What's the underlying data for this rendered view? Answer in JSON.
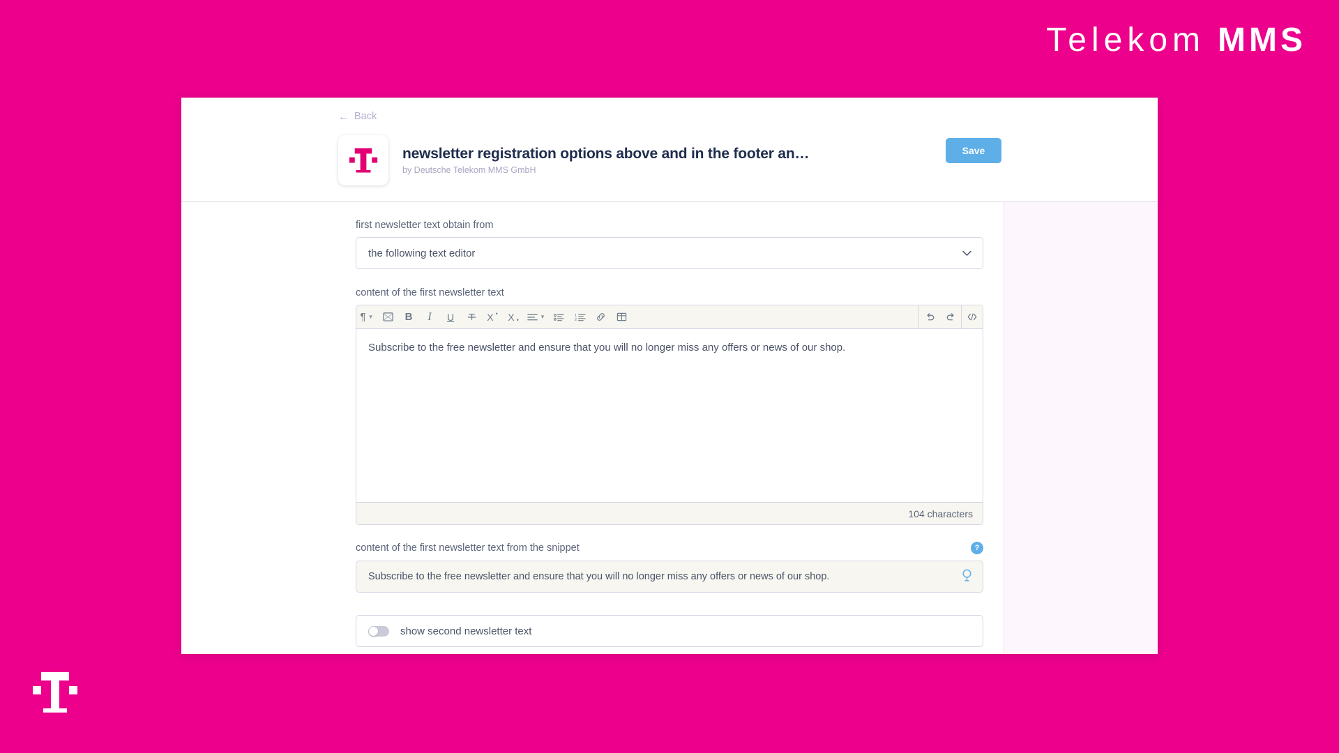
{
  "brand": {
    "wordmark_light": "Telekom",
    "wordmark_bold": "MMS",
    "magenta": "#EC008C",
    "corner_logo_name": "telekom-t-logo"
  },
  "header": {
    "back_label": "Back",
    "back_arrow": "←",
    "app_icon_name": "telekom-t-app-icon",
    "title": "newsletter registration options above and in the footer an…",
    "subtitle": "by Deutsche Telekom MMS GmbH",
    "save_label": "Save",
    "save_color": "#5EAEE8"
  },
  "form": {
    "source_field": {
      "label": "first newsletter text obtain from",
      "value": "the following text editor",
      "options": [
        "the following text editor"
      ]
    },
    "editor_field": {
      "label": "content of the first newsletter text",
      "content": "Subscribe to the free newsletter and ensure that you will no longer miss any offers or news of our shop.",
      "character_count": "104 characters",
      "toolbar": {
        "left": [
          {
            "name": "paragraph-style-icon",
            "glyph": "¶",
            "has_chevron": true
          },
          {
            "name": "insert-image-icon",
            "glyph": "image",
            "has_chevron": false
          },
          {
            "name": "bold-icon",
            "glyph": "B",
            "has_chevron": false
          },
          {
            "name": "italic-icon",
            "glyph": "I",
            "has_chevron": false
          },
          {
            "name": "underline-icon",
            "glyph": "U",
            "has_chevron": false
          },
          {
            "name": "strikethrough-icon",
            "glyph": "S",
            "has_chevron": false
          },
          {
            "name": "superscript-icon",
            "glyph": "X²",
            "has_chevron": false
          },
          {
            "name": "subscript-icon",
            "glyph": "X₂",
            "has_chevron": false
          },
          {
            "name": "align-icon",
            "glyph": "align",
            "has_chevron": true
          },
          {
            "name": "bullet-list-icon",
            "glyph": "bullets",
            "has_chevron": false
          },
          {
            "name": "numbered-list-icon",
            "glyph": "numbers",
            "has_chevron": false
          },
          {
            "name": "insert-link-icon",
            "glyph": "link",
            "has_chevron": false
          },
          {
            "name": "insert-table-icon",
            "glyph": "table",
            "has_chevron": false
          }
        ],
        "right": [
          {
            "name": "undo-icon",
            "glyph": "undo"
          },
          {
            "name": "redo-icon",
            "glyph": "redo"
          },
          {
            "name": "source-code-icon",
            "glyph": "code"
          }
        ]
      }
    },
    "snippet_field": {
      "label": "content of the first newsletter text from the snippet",
      "help_badge": "?",
      "value": "Subscribe to the free newsletter and ensure that you will no longer miss any offers or news of our shop.",
      "action_icon_name": "snippet-search-icon"
    },
    "second_text_toggle": {
      "label": "show second newsletter text",
      "state": "off"
    }
  }
}
